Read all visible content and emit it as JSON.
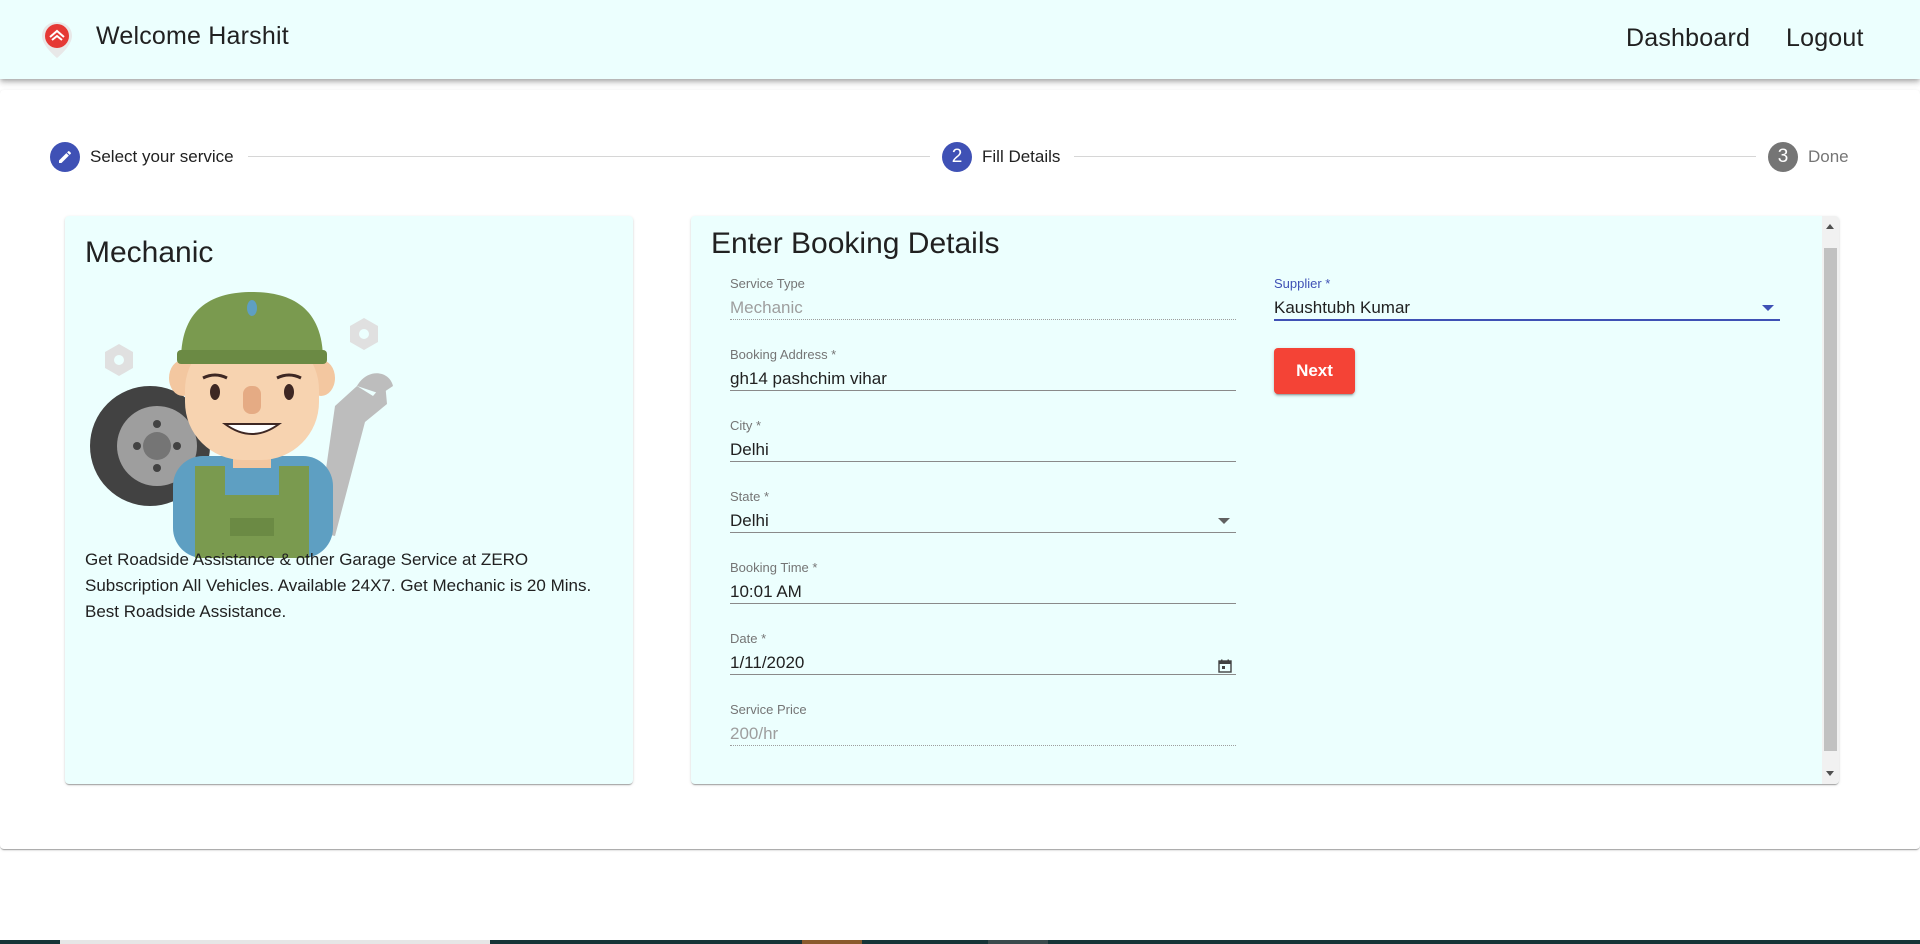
{
  "header": {
    "logo_icon": "location-pin-logo-icon",
    "welcome_text": "Welcome Harshit",
    "nav": {
      "dashboard_label": "Dashboard",
      "logout_label": "Logout"
    }
  },
  "stepper": {
    "steps": [
      {
        "label": "Select your service",
        "state": "completed",
        "icon": "pencil-edit-icon"
      },
      {
        "label": "Fill Details",
        "state": "active",
        "number": "2"
      },
      {
        "label": "Done",
        "state": "inactive",
        "number": "3"
      }
    ]
  },
  "service_card": {
    "title": "Mechanic",
    "illustration": "mechanic-illustration",
    "description": "Get Roadside Assistance & other Garage Service at ZERO Subscription All Vehicles. Available 24X7. Get Mechanic is 20 Mins. Best Roadside Assistance."
  },
  "booking_form": {
    "title": "Enter Booking Details",
    "fields": {
      "service_type": {
        "label": "Service Type",
        "value": "Mechanic"
      },
      "booking_address": {
        "label": "Booking Address *",
        "value": "gh14 pashchim vihar"
      },
      "city": {
        "label": "City *",
        "value": "Delhi"
      },
      "state": {
        "label": "State *",
        "value": "Delhi"
      },
      "booking_time": {
        "label": "Booking Time *",
        "value": "10:01 AM"
      },
      "date": {
        "label": "Date *",
        "value": "1/11/2020"
      },
      "service_price": {
        "label": "Service Price",
        "value": "200/hr"
      },
      "supplier": {
        "label": "Supplier *",
        "value": "Kaushtubh Kumar"
      }
    },
    "next_label": "Next"
  },
  "colors": {
    "appbar_bg": "#ecfffe",
    "primary": "#3f51b5",
    "accent_button": "#f44336"
  }
}
